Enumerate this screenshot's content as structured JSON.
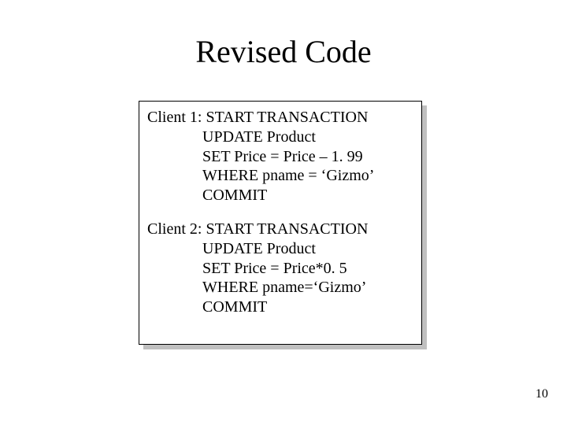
{
  "title": "Revised Code",
  "client1": {
    "header_prefix": "Client 1: ",
    "start": "START TRANSACTION",
    "update_kw": "UPDATE ",
    "update_tbl": "Product",
    "set_kw": "SET ",
    "set_expr": "Price = Price – 1. 99",
    "where_kw": "WHERE ",
    "where_expr": "pname = ‘Gizmo’",
    "commit": "COMMIT"
  },
  "client2": {
    "header_prefix": "Client 2: ",
    "start": "START TRANSACTION",
    "update_kw": "UPDATE ",
    "update_tbl": "Product",
    "set_kw": "SET ",
    "set_expr": "Price = Price*0. 5",
    "where_kw": "WHERE ",
    "where_expr": "pname=‘Gizmo’",
    "commit": "COMMIT"
  },
  "page_number": "10"
}
